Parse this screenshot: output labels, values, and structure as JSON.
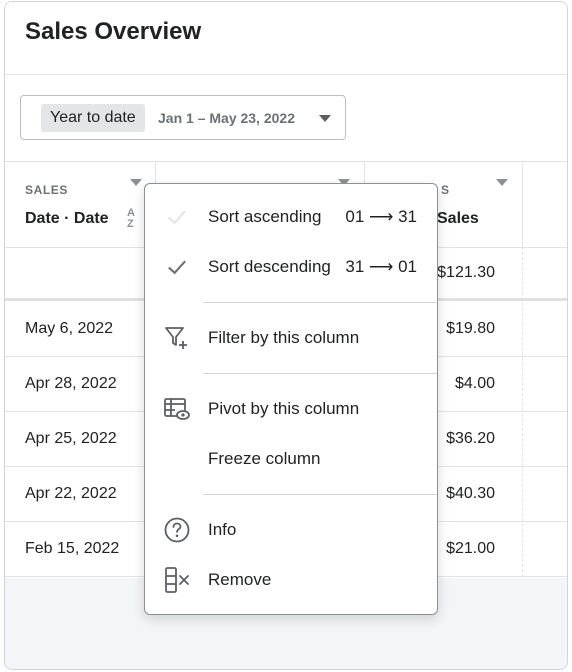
{
  "card": {
    "title": "Sales Overview"
  },
  "date_picker": {
    "range_label": "Year to date",
    "range_dates": "Jan 1 – May 23, 2022"
  },
  "table": {
    "columns": [
      {
        "section": "SALES",
        "title": "Date · Date"
      },
      {
        "section": "",
        "title": ""
      },
      {
        "section": "S",
        "title": "Sales"
      }
    ],
    "total_row": {
      "sales": "$121.30"
    },
    "rows": [
      {
        "date": "May 6, 2022",
        "sales": "$19.80"
      },
      {
        "date": "Apr 28, 2022",
        "sales": "$4.00"
      },
      {
        "date": "Apr 25, 2022",
        "sales": "$36.20"
      },
      {
        "date": "Apr 22, 2022",
        "sales": "$40.30"
      },
      {
        "date": "Feb 15, 2022",
        "sales": "$21.00"
      }
    ]
  },
  "context_menu": {
    "items": [
      {
        "label": "Sort ascending",
        "shortcut": "01 ⟶ 31",
        "icon": "check-icon",
        "checked": false
      },
      {
        "label": "Sort descending",
        "shortcut": "31 ⟶ 01",
        "icon": "check-icon",
        "checked": true
      },
      {
        "label": "Filter by this column",
        "icon": "filter-add-icon"
      },
      {
        "label": "Pivot by this column",
        "icon": "pivot-table-icon"
      },
      {
        "label": "Freeze column",
        "icon": ""
      },
      {
        "label": "Info",
        "icon": "question-circle-icon"
      },
      {
        "label": "Remove",
        "icon": "remove-column-icon"
      }
    ]
  }
}
